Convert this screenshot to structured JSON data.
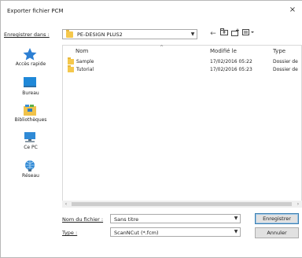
{
  "window": {
    "title": "Exporter fichier PCM",
    "close_label": "×"
  },
  "save_in": {
    "label": "Enregistrer dans :",
    "value": "PE-DESIGN PLUS2"
  },
  "toolbar": [
    "back-icon",
    "up-folder-icon",
    "new-folder-icon",
    "view-menu-icon"
  ],
  "places": [
    {
      "label": "Accès rapide",
      "icon": "star-icon"
    },
    {
      "label": "Bureau",
      "icon": "desktop-icon"
    },
    {
      "label": "Bibliothèques",
      "icon": "libraries-icon"
    },
    {
      "label": "Ce PC",
      "icon": "computer-icon"
    },
    {
      "label": "Réseau",
      "icon": "network-icon"
    }
  ],
  "columns": [
    "Nom",
    "Modifié le",
    "Type"
  ],
  "files": [
    {
      "name": "Sample",
      "modified": "17/02/2016 05:22",
      "type": "Dossier de"
    },
    {
      "name": "Tutorial",
      "modified": "17/02/2016 05:23",
      "type": "Dossier de"
    }
  ],
  "filename": {
    "label": "Nom du fichier :",
    "value": "Sans titre"
  },
  "filetype": {
    "label": "Type :",
    "value": "ScanNCut (*.fcm)"
  },
  "buttons": {
    "save": "Enregistrer",
    "cancel": "Annuler"
  }
}
